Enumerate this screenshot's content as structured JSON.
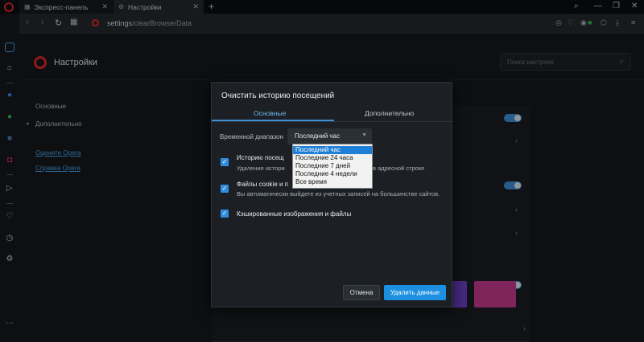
{
  "tabs": [
    {
      "label": "Экспресс-панель",
      "icon": "grid-icon"
    },
    {
      "label": "Настройки",
      "icon": "gear-icon"
    }
  ],
  "address": {
    "host": "settings",
    "path": "/clearBrowserData"
  },
  "header": {
    "title": "Настройки",
    "search_placeholder": "Поиск настроек"
  },
  "leftnav": {
    "basic": "Основные",
    "advanced": "Дополнительно",
    "rate": "Оцените Opera",
    "help": "Справка Opera"
  },
  "dialog": {
    "title": "Очистить историю посещений",
    "tabs": [
      "Основные",
      "Дополнительно"
    ],
    "time_range_label": "Временной диапазон",
    "time_range_value": "Последний час",
    "options": [
      "Последний час",
      "Последние 24 часа",
      "Последние 7 дней",
      "Последние 4 недели",
      "Все время"
    ],
    "items": [
      {
        "title": "Историю посещ",
        "desc": "Удаление истори",
        "desc_tail": "в адресной строке",
        "checked": true
      },
      {
        "title": "Файлы cookie и п",
        "desc": "Вы автоматически выйдете из учетных записей на большинстве сайтов.",
        "checked": true
      },
      {
        "title": "Кэшированные изображения и файлы",
        "desc": "",
        "checked": true
      }
    ],
    "cancel": "Отмена",
    "delete": "Удалить данные"
  },
  "colors": {
    "accent": "#1d8fe0",
    "opera_red": "#e0262f"
  }
}
